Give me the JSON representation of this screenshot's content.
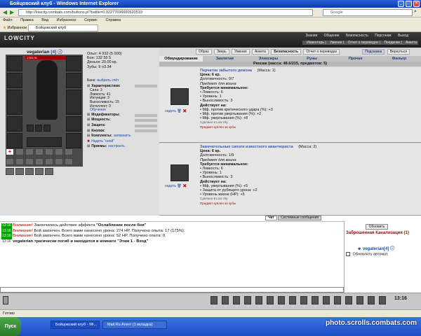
{
  "window": {
    "title": "Бойцовский клуб - Windows Internet Explorer"
  },
  "browser": {
    "address": "http://lowcity.combats.com/buttons.pl?battle=0.92277696600520519",
    "search_placeholder": "Google",
    "menu": [
      "Файл",
      "Правка",
      "Вид",
      "Избранное",
      "Сервис",
      "Справка"
    ],
    "favorites_label": "Избранное",
    "tab_label": "Бойцовский клуб"
  },
  "game_header": {
    "logo": "LOWCITY",
    "menu1": [
      "Знания",
      "Общение",
      "Безопасность",
      "Персонаж",
      "Выход"
    ],
    "menu2": [
      "Инвентарь",
      "Умения",
      "Отчет о переводах",
      "Поединки",
      "Анкета"
    ]
  },
  "character": {
    "name": "vegaterian",
    "level": "[4]",
    "hp": "178/178",
    "stats": [
      {
        "label": "Опыт:",
        "value": "4 932 (5 000)"
      },
      {
        "label": "Бон:",
        "value": "132 55 5"
      },
      {
        "label": "Деньги:",
        "value": "20.00 кр."
      },
      {
        "label": "Зубы:",
        "value": "9 ¤3.34"
      }
    ],
    "bank_label": "Банк:",
    "bank_link": "выбрать счёт",
    "characteristics_label": "Характеристики:",
    "attributes": [
      {
        "label": "Сила:",
        "value": "3"
      },
      {
        "label": "Ловкость:",
        "value": "41"
      },
      {
        "label": "Интуиция:",
        "value": "3"
      },
      {
        "label": "Выносливость:",
        "value": "15"
      },
      {
        "label": "Интеллект:",
        "value": "0"
      }
    ],
    "training_link": "Обучение",
    "sections": [
      "Модификаторы:",
      "Мощность:",
      "Защита:",
      "Кнопки:",
      "Комплекты:"
    ],
    "save_label": "запомнить",
    "set_label": "Надеть \"оеей\"",
    "techniques_label": "Приемы:",
    "configure_link": "настроить"
  },
  "right_tabs": {
    "top": [
      "Образ",
      "Зверь",
      "Умения",
      "Анкета",
      "Безопасность",
      "Отчет о переводах"
    ],
    "hint": "Подсказка",
    "return": "Вернуться",
    "categories": [
      "Обмундирование",
      "Заклятия",
      "Эликсиры",
      "Руны",
      "Прочее",
      "Фильтр"
    ]
  },
  "inventory": {
    "header": "Рюкзак (масса: 48.6/215, предметов: 5)",
    "items": [
      {
        "name": "Перчатки забытого демона",
        "qty": "(Масса: 1)",
        "price": "Цена: 6 кр.",
        "durability": "Долговечность: 0/7",
        "type": "Предмет для воина",
        "req_title": "Требуется минимальное:",
        "reqs": [
          "• Ловкость: 6",
          "• Уровень: 1",
          "• Выносливость: 3"
        ],
        "eff_title": "Действует на:",
        "effs": [
          "• Мф. против критического удара (%): +3",
          "• Мф. против увертывания (%): +2",
          "• Мф. увертывания (%): +8"
        ],
        "made": "Сделано в Low city",
        "note": "Предмет куплен за зубы",
        "wear_label": "надеть"
      },
      {
        "name": "Замечательные сапоги известного авантюриста",
        "qty": "(Масса: 2)",
        "price": "Цена: 6 кр.",
        "durability": "Долговечность: 1/9",
        "type": "Предмет для воина",
        "req_title": "Требуется минимальное:",
        "reqs": [
          "• Ловкость: 6",
          "• Уровень: 1",
          "• Выносливость: 3"
        ],
        "eff_title": "Действует на:",
        "effs": [
          "• Мф. увертывания (%): +5",
          "• Защита от рубящего урона: +2",
          "• Уровень жизни (HP): +5"
        ],
        "made": "Сделано в Low city",
        "note": "Предмет куплен за зубы",
        "wear_label": "надеть"
      }
    ]
  },
  "chat": {
    "tabs": [
      "Чат",
      "Системные сообщения"
    ],
    "lines": [
      {
        "time": "13:16",
        "highlight": true,
        "prefix": "Внимание!",
        "text": "Закончилось действие эффекта",
        "bold": "\"Ослабление после боя\""
      },
      {
        "time": "13:16",
        "highlight": true,
        "prefix": "Внимание!",
        "text": "Бой закончен. Всего вами нанесено урона: 274 HP. Получено опыта: 17 (175%).",
        "bold": ""
      },
      {
        "time": "13:16",
        "highlight": true,
        "prefix": "Внимание!",
        "text": "Бой закончен. Всего вами нанесено урона: 52 HP. Получено опыта: 0.",
        "bold": ""
      },
      {
        "time": "13:16",
        "highlight": false,
        "prefix": "",
        "text": "vegaterian трагически погиб и находится в комнате \"Этаж 1 - Вход\"",
        "bold": ""
      }
    ]
  },
  "room": {
    "refresh_label": "Обновить",
    "name": "Заброшенная Канализация (1)",
    "user": "vegaterian[4]",
    "auto_label": "Обновлять автомат."
  },
  "clock": "13:16",
  "status": {
    "text": "Готово"
  },
  "taskbar": {
    "start": "Пуск",
    "tasks": [
      "Бойцовский клуб - Wi...",
      "Mail.Ru Агент (1 вкладка)"
    ],
    "watermark": "photo.scrolls.combats.com"
  },
  "colors": {
    "accent": "#1a4aaa",
    "room_title": "#8a0b0b",
    "chat_time": "#00a000",
    "warning": "#a00000"
  }
}
